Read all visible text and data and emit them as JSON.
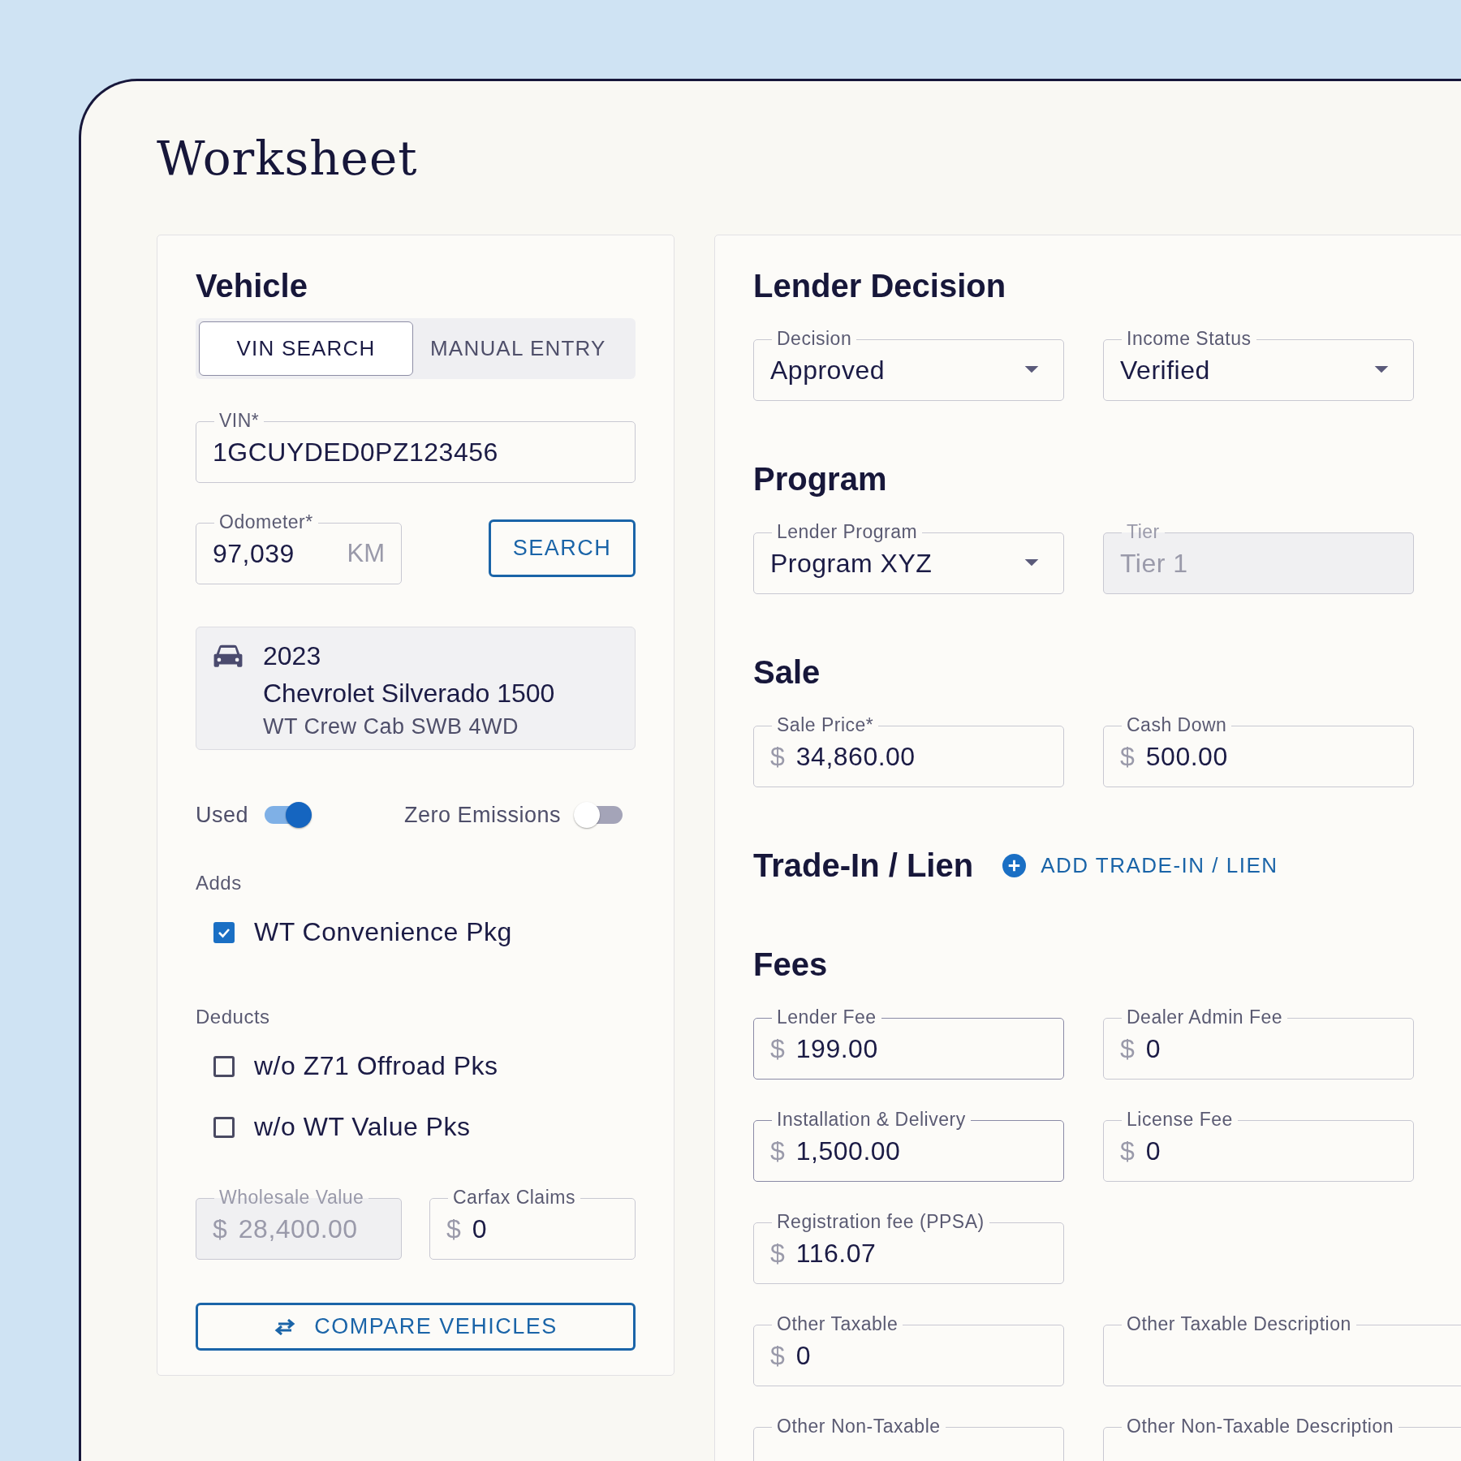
{
  "title": "Worksheet",
  "vehicle": {
    "heading": "Vehicle",
    "tabs": [
      {
        "label": "VIN SEARCH",
        "selected": true
      },
      {
        "label": "MANUAL ENTRY",
        "selected": false
      }
    ],
    "vin": {
      "label": "VIN*",
      "value": "1GCUYDED0PZ123456"
    },
    "odometer": {
      "label": "Odometer*",
      "value": "97,039",
      "unit": "KM"
    },
    "search_button": "SEARCH",
    "result": {
      "year": "2023",
      "model": "Chevrolet Silverado 1500",
      "trim": "WT Crew Cab SWB 4WD"
    },
    "toggles": [
      {
        "label": "Used",
        "on": true
      },
      {
        "label": "Zero Emissions",
        "on": false
      }
    ],
    "option_groups": [
      {
        "heading": "Adds",
        "options": [
          {
            "label": "WT Convenience Pkg",
            "checked": true
          }
        ]
      },
      {
        "heading": "Deducts",
        "options": [
          {
            "label": "w/o Z71 Offroad Pks",
            "checked": false
          },
          {
            "label": "w/o WT Value Pks",
            "checked": false
          }
        ]
      }
    ],
    "value_fields": [
      {
        "label": "Wholesale Value",
        "prefix": "$",
        "value": "28,400.00",
        "disabled": true
      },
      {
        "label": "Carfax Claims",
        "prefix": "$",
        "value": "0",
        "disabled": false
      }
    ],
    "compare_button": "COMPARE VEHICLES"
  },
  "sections": [
    {
      "heading": "Lender Decision",
      "rows": [
        {
          "fields": [
            {
              "kind": "select",
              "label": "Decision",
              "value": "Approved",
              "disabled": false,
              "emphasized": false
            },
            {
              "kind": "select",
              "label": "Income Status",
              "value": "Verified",
              "disabled": false,
              "emphasized": false
            }
          ]
        }
      ]
    },
    {
      "heading": "Program",
      "rows": [
        {
          "fields": [
            {
              "kind": "select",
              "label": "Lender Program",
              "value": "Program XYZ",
              "disabled": false,
              "emphasized": false
            },
            {
              "kind": "text",
              "label": "Tier",
              "value": "Tier 1",
              "disabled": true,
              "emphasized": false
            }
          ]
        }
      ]
    },
    {
      "heading": "Sale",
      "rows": [
        {
          "fields": [
            {
              "kind": "text",
              "label": "Sale Price*",
              "prefix": "$",
              "value": "34,860.00",
              "disabled": false,
              "emphasized": false
            },
            {
              "kind": "text",
              "label": "Cash Down",
              "prefix": "$",
              "value": "500.00",
              "disabled": false,
              "emphasized": false
            }
          ]
        }
      ]
    },
    {
      "heading": "Trade-In / Lien",
      "action": "ADD TRADE-IN / LIEN"
    },
    {
      "heading": "Fees",
      "rows": [
        {
          "fields": [
            {
              "kind": "text",
              "label": "Lender Fee",
              "prefix": "$",
              "value": "199.00",
              "disabled": false,
              "emphasized": true
            },
            {
              "kind": "text",
              "label": "Dealer Admin Fee",
              "prefix": "$",
              "value": "0",
              "disabled": false,
              "emphasized": false
            }
          ]
        },
        {
          "fields": [
            {
              "kind": "text",
              "label": "Installation & Delivery",
              "prefix": "$",
              "value": "1,500.00",
              "disabled": false,
              "emphasized": true
            },
            {
              "kind": "text",
              "label": "License Fee",
              "prefix": "$",
              "value": "0",
              "disabled": false,
              "emphasized": false
            }
          ]
        },
        {
          "fields": [
            {
              "kind": "text",
              "label": "Registration fee (PPSA)",
              "prefix": "$",
              "value": "116.07",
              "disabled": false,
              "emphasized": false
            }
          ]
        },
        {
          "fields": [
            {
              "kind": "text",
              "label": "Other Taxable",
              "prefix": "$",
              "value": "0",
              "disabled": false,
              "emphasized": false
            },
            {
              "kind": "description",
              "label": "Other Taxable Description",
              "disabled": false,
              "emphasized": false
            }
          ]
        },
        {
          "fields": [
            {
              "kind": "text",
              "label": "Other Non-Taxable",
              "disabled": false,
              "emphasized": false
            },
            {
              "kind": "description",
              "label": "Other Non-Taxable Description",
              "disabled": false,
              "emphasized": false
            }
          ]
        }
      ]
    }
  ]
}
